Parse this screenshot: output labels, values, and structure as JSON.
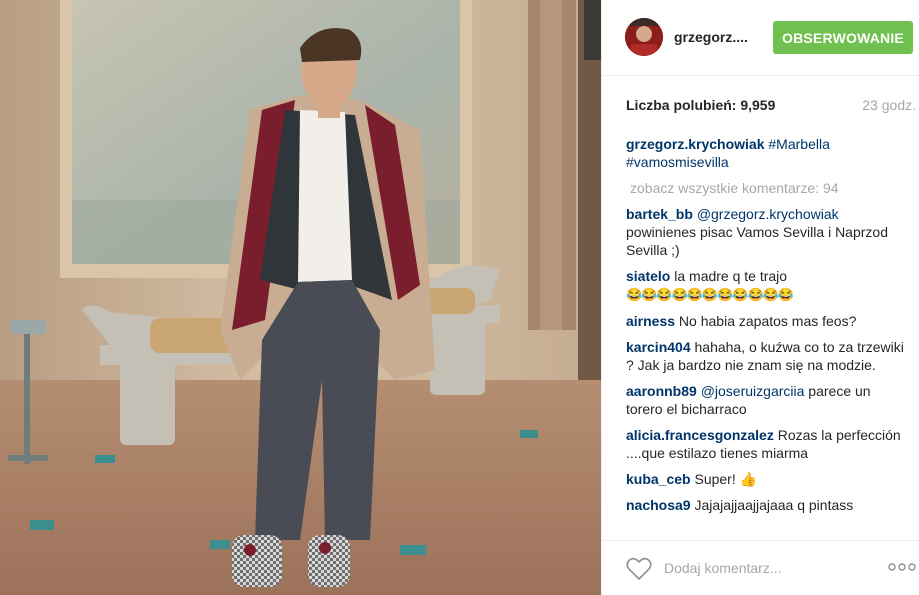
{
  "post": {
    "username": "grzegorz....",
    "follow_label": "OBSERWOWANIE",
    "likes_label": "Liczba polubień: ",
    "likes_count": "9,959",
    "time": "23 godz."
  },
  "caption": {
    "user": "grzegorz.krychowiak",
    "tag1": "#Marbella",
    "tag2": "#vamosmisevilla"
  },
  "view_all": "zobacz wszystkie komentarze: 94",
  "comments": [
    {
      "user": "bartek_bb",
      "mention": "@grzegorz.krychowiak",
      "text": " powinienes pisac Vamos Sevilla i Naprzod Sevilla ;)"
    },
    {
      "user": "siatelo",
      "text": " la madre q te trajo",
      "emoji": "😂😂😂😂😂😂😂😂😂😂😂"
    },
    {
      "user": "airness",
      "text": " No habia zapatos mas feos?"
    },
    {
      "user": "karcin404",
      "text": " hahaha, o kuźwa co to za trzewiki ? Jak ja bardzo nie znam się na modzie."
    },
    {
      "user": "aaronnb89",
      "mention": "@joseruizgarciia",
      "text": " parece un torero el bicharraco"
    },
    {
      "user": "alicia.francesgonzalez",
      "text": " Rozas la perfección ....que estilazo tienes miarma"
    },
    {
      "user": "kuba_ceb",
      "text": " Super! 👍"
    },
    {
      "user": "nachosa9",
      "text": " Jajajajjaajjajaaa q pintass"
    }
  ],
  "footer": {
    "placeholder": "Dodaj komentarz...",
    "like_icon": "heart-icon",
    "more_icon": "ellipsis-icon"
  },
  "colors": {
    "follow_bg": "#70c050",
    "link": "#003569",
    "muted": "#a5a7aa"
  }
}
